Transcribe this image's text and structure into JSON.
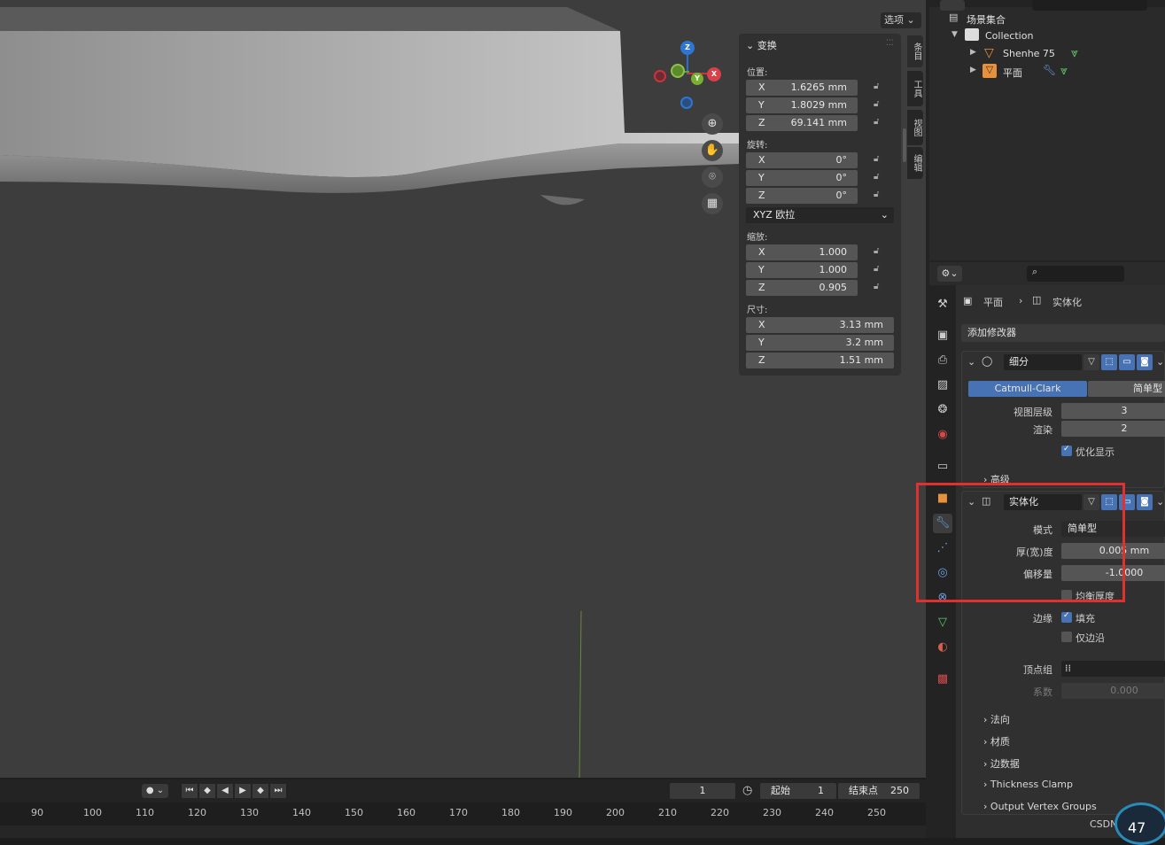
{
  "viewport": {
    "options_label": "选项",
    "gizmo": {
      "z": "Z",
      "x": "X",
      "y": "Y"
    }
  },
  "npanel": {
    "section": "变换",
    "location_label": "位置:",
    "location": [
      {
        "axis": "X",
        "value": "1.6265 mm"
      },
      {
        "axis": "Y",
        "value": "1.8029 mm"
      },
      {
        "axis": "Z",
        "value": "69.141 mm"
      }
    ],
    "rotation_label": "旋转:",
    "rotation": [
      {
        "axis": "X",
        "value": "0°"
      },
      {
        "axis": "Y",
        "value": "0°"
      },
      {
        "axis": "Z",
        "value": "0°"
      }
    ],
    "rotation_mode": "XYZ 欧拉",
    "scale_label": "缩放:",
    "scale": [
      {
        "axis": "X",
        "value": "1.000"
      },
      {
        "axis": "Y",
        "value": "1.000"
      },
      {
        "axis": "Z",
        "value": "0.905"
      }
    ],
    "dimensions_label": "尺寸:",
    "dimensions": [
      {
        "axis": "X",
        "value": "3.13 mm"
      },
      {
        "axis": "Y",
        "value": "3.2 mm"
      },
      {
        "axis": "Z",
        "value": "1.51 mm"
      }
    ]
  },
  "sidetabs": [
    "条目",
    "工具",
    "视图",
    "编辑"
  ],
  "outliner": {
    "scene_collection": "场景集合",
    "collection": "Collection",
    "objects": [
      "Shenhe 75",
      "平面"
    ]
  },
  "properties": {
    "breadcrumb_obj": "平面",
    "breadcrumb_mod": "实体化",
    "add_modifier": "添加修改器",
    "subdiv": {
      "name": "细分",
      "mode_a": "Catmull-Clark",
      "mode_b": "简单型",
      "levels_label": "视图层级",
      "levels": "3",
      "render_label": "渲染",
      "render": "2",
      "optimal": "优化显示",
      "advanced": "高级"
    },
    "solidify": {
      "name": "实体化",
      "mode_label": "模式",
      "mode": "简单型",
      "thickness_label": "厚(宽)度",
      "thickness": "0.005 mm",
      "offset_label": "偏移量",
      "offset": "-1.0000",
      "even": "均衡厚度",
      "rim_label": "边缘",
      "fill": "填充",
      "rim_only": "仅边沿",
      "vgroup_label": "顶点组",
      "factor_label": "系数",
      "factor": "0.000",
      "sections": [
        "法向",
        "材质",
        "边数据",
        "Thickness Clamp",
        "Output Vertex Groups"
      ]
    }
  },
  "timeline": {
    "current": "1",
    "start_label": "起始",
    "start": "1",
    "end_label": "结束点",
    "end": "250",
    "ticks": [
      "90",
      "100",
      "110",
      "120",
      "130",
      "140",
      "150",
      "160",
      "170",
      "180",
      "190",
      "200",
      "210",
      "220",
      "230",
      "240",
      "250"
    ]
  },
  "watermark": "CSDN @厕",
  "fps_badge": "47"
}
